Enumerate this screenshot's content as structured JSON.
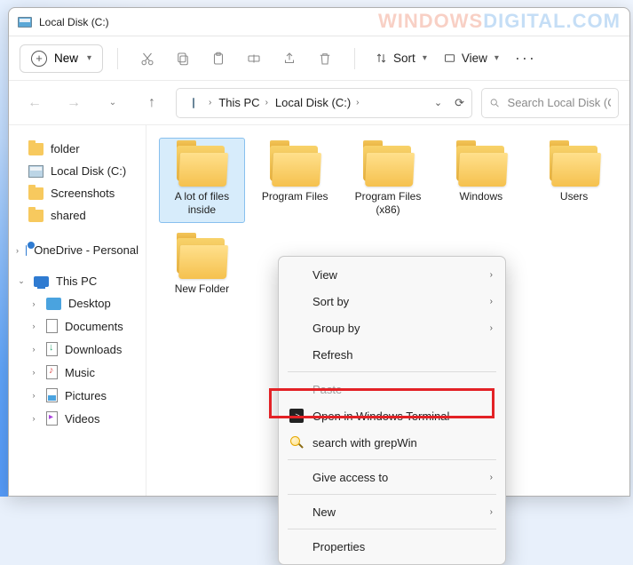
{
  "window": {
    "title": "Local Disk (C:)"
  },
  "watermark": {
    "p1": "WINDOWS",
    "p2": "DIGITAL.COM"
  },
  "toolbar": {
    "new_label": "New",
    "sort_label": "Sort",
    "view_label": "View"
  },
  "breadcrumb": {
    "items": [
      "This PC",
      "Local Disk (C:)"
    ]
  },
  "search": {
    "placeholder": "Search Local Disk (C:)"
  },
  "sidebar": {
    "quick": [
      {
        "label": "folder",
        "icon": "folder"
      },
      {
        "label": "Local Disk (C:)",
        "icon": "drive"
      },
      {
        "label": "Screenshots",
        "icon": "folder"
      },
      {
        "label": "shared",
        "icon": "folder"
      }
    ],
    "onedrive": {
      "label": "OneDrive - Personal"
    },
    "thispc": {
      "label": "This PC",
      "children": [
        {
          "label": "Desktop",
          "icon": "desk"
        },
        {
          "label": "Documents",
          "icon": "doc"
        },
        {
          "label": "Downloads",
          "icon": "dl"
        },
        {
          "label": "Music",
          "icon": "music"
        },
        {
          "label": "Pictures",
          "icon": "pic"
        },
        {
          "label": "Videos",
          "icon": "vid"
        }
      ]
    }
  },
  "folders": [
    {
      "label": "A lot of files inside",
      "selected": true
    },
    {
      "label": "Program Files"
    },
    {
      "label": "Program Files (x86)"
    },
    {
      "label": "Windows"
    },
    {
      "label": "Users"
    },
    {
      "label": "New Folder"
    }
  ],
  "context_menu": {
    "view": "View",
    "sort_by": "Sort by",
    "group_by": "Group by",
    "refresh": "Refresh",
    "paste": "Paste",
    "open_terminal": "Open in Windows Terminal",
    "grepwin": "search with grepWin",
    "give_access": "Give access to",
    "new": "New",
    "properties": "Properties"
  }
}
